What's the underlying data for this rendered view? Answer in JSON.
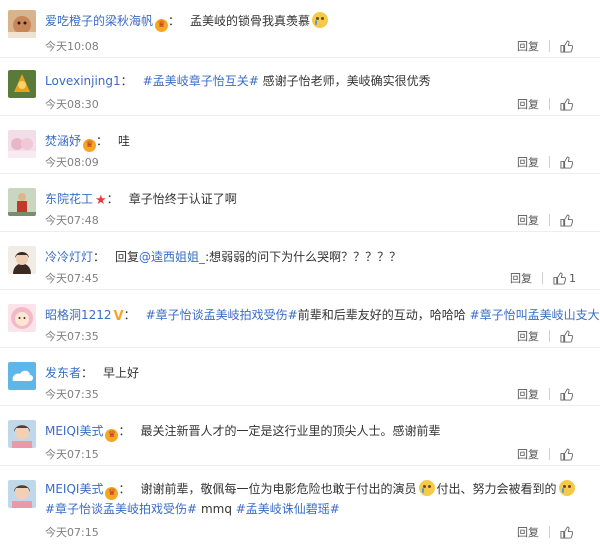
{
  "comments": [
    {
      "user": "爱吃橙子的梁秋海帆",
      "badge": "crown-badge",
      "segments": [
        {
          "type": "text",
          "value": "孟美岐的锁骨我真羡慕"
        }
      ],
      "emoji": "crying-emoji",
      "time": "今天10:08",
      "reply_label": "回复",
      "likes": ""
    },
    {
      "user": "Lovexinjing1",
      "badge": "",
      "segments": [
        {
          "type": "topic",
          "value": "#孟美岐章子怡互关#"
        },
        {
          "type": "text",
          "value": " 感谢子怡老师，美岐确实很优秀"
        }
      ],
      "time": "今天08:30",
      "reply_label": "回复",
      "likes": ""
    },
    {
      "user": "焚涵妤",
      "badge": "crown-badge",
      "segments": [
        {
          "type": "text",
          "value": "哇"
        }
      ],
      "time": "今天08:09",
      "reply_label": "回复",
      "likes": ""
    },
    {
      "user": "东院花工",
      "badge": "star-badge",
      "segments": [
        {
          "type": "text",
          "value": "章子怡终于认证了啊"
        }
      ],
      "time": "今天07:48",
      "reply_label": "回复",
      "likes": ""
    },
    {
      "user": "冷冷灯灯",
      "badge": "",
      "segments": [
        {
          "type": "text",
          "value": "回复"
        },
        {
          "type": "mention",
          "value": "@逵西姐姐_"
        },
        {
          "type": "text",
          "value": ":想弱弱的问下为什么哭啊？？？？？"
        }
      ],
      "time": "今天07:45",
      "reply_label": "回复",
      "likes": "1"
    },
    {
      "user": "昭格洞1212",
      "badge": "vip-badge",
      "segments": [
        {
          "type": "topic",
          "value": "#章子怡谈孟美岐拍戏受伤#"
        },
        {
          "type": "text",
          "value": "前辈和后辈友好的互动，哈哈哈 "
        },
        {
          "type": "topic",
          "value": "#章子怡叫孟美岐山支大哥#"
        }
      ],
      "time": "今天07:35",
      "reply_label": "回复",
      "likes": ""
    },
    {
      "user": "发东者",
      "badge": "",
      "segments": [
        {
          "type": "text",
          "value": "早上好"
        }
      ],
      "time": "今天07:35",
      "reply_label": "回复",
      "likes": ""
    },
    {
      "user": "MEIQI美式",
      "badge": "crown-badge",
      "segments": [
        {
          "type": "text",
          "value": "最关注新晋人才的一定是这行业里的顶尖人士。感谢前辈"
        }
      ],
      "time": "今天07:15",
      "reply_label": "回复",
      "likes": ""
    },
    {
      "user": "MEIQI美式",
      "badge": "crown-badge",
      "segments": [
        {
          "type": "text",
          "value": "谢谢前辈，敬佩每一位为电影危险也敢于付出的演员"
        },
        {
          "type": "emoji",
          "value": "crying-emoji"
        },
        {
          "type": "text",
          "value": "付出、努力会被看到的"
        },
        {
          "type": "emoji",
          "value": "crying-emoji"
        },
        {
          "type": "topic",
          "value": "#章子怡谈孟美岐拍戏受伤#"
        },
        {
          "type": "text",
          "value": " mmq "
        },
        {
          "type": "topic",
          "value": "#孟美岐诛仙碧瑶#"
        }
      ],
      "time": "今天07:15",
      "reply_label": "回复",
      "likes": ""
    }
  ],
  "colors": {
    "link": "#3a6cc4",
    "text": "#333333",
    "time": "#808080",
    "divider": "#eeeeee"
  }
}
